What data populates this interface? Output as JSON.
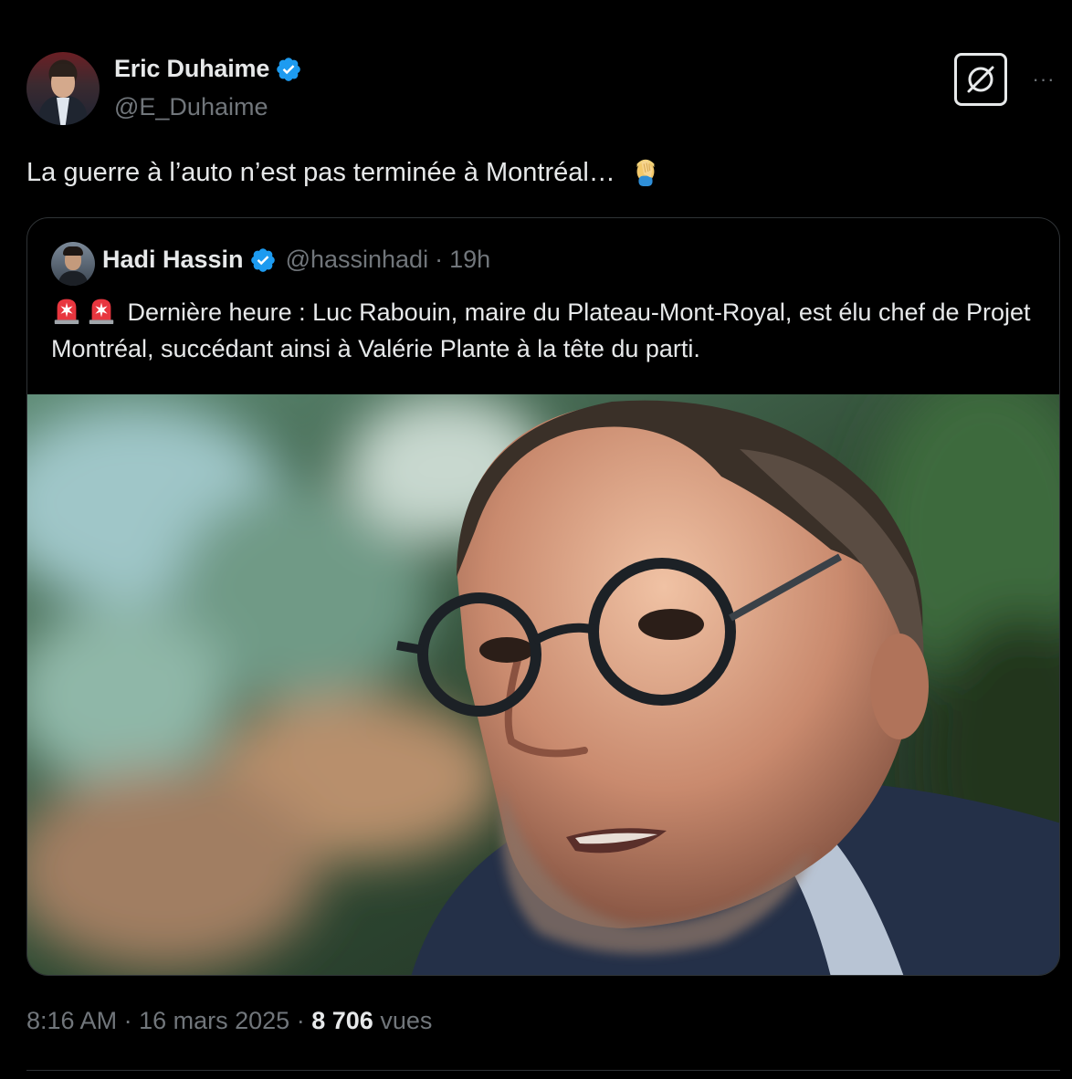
{
  "author": {
    "name": "Eric Duhaime",
    "handle": "@E_Duhaime",
    "verified": true,
    "avatar": "avatar-photo"
  },
  "header_actions": {
    "grok_icon": "grok-icon",
    "more_icon": "more-icon",
    "more_label": "···"
  },
  "tweet": {
    "text": "La guerre à l’auto n’est pas terminée à Montréal… ",
    "emoji": "facepalm-emoji"
  },
  "quote": {
    "author_name": "Hadi Hassin",
    "author_handle": "@hassinhadi",
    "separator": "·",
    "time": "19h",
    "verified": true,
    "emojis": [
      "police-light-emoji",
      "police-light-emoji"
    ],
    "text": "Dernière heure : Luc Rabouin, maire du Plateau-Mont-Royal, est élu chef de Projet Montréal, succédant ainsi à Valérie Plante à la tête du parti.",
    "image": "portrait-photo"
  },
  "footer": {
    "time": "8:16 AM",
    "sep1": "·",
    "date": "16 mars 2025",
    "sep2": "·",
    "views_count": "8 706",
    "views_label": "vues"
  },
  "colors": {
    "background": "#000000",
    "text": "#e7e9ea",
    "secondary": "#71767b",
    "verified": "#1d9bf0",
    "border": "#2f3336"
  }
}
